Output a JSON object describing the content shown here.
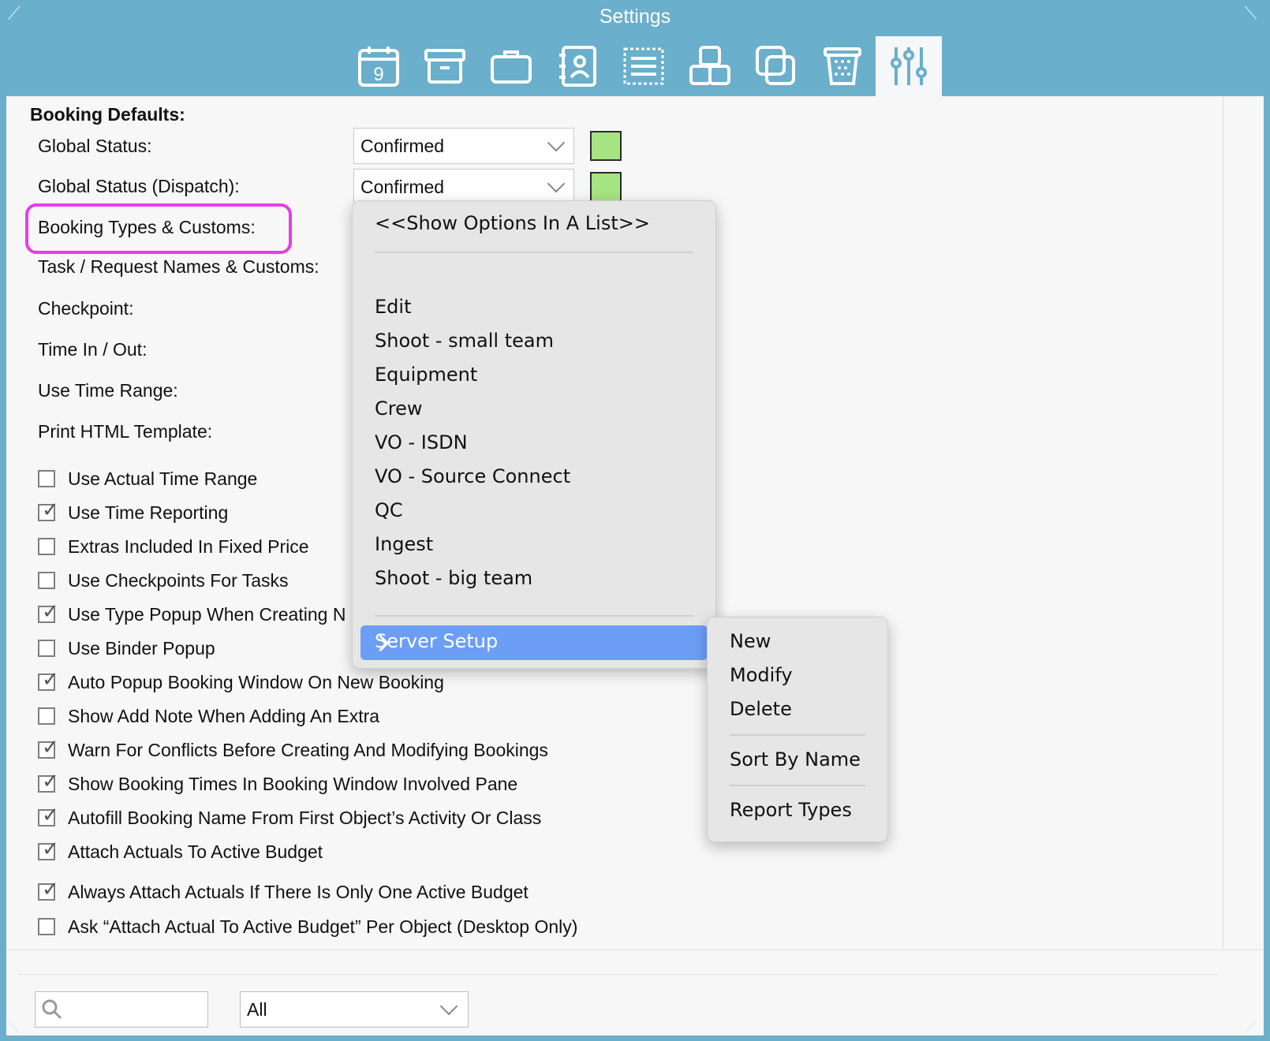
{
  "window": {
    "title": "Settings"
  },
  "toolbar": {
    "tools": [
      {
        "name": "calendar-icon",
        "day": "9"
      },
      {
        "name": "archive-box-icon"
      },
      {
        "name": "briefcase-icon"
      },
      {
        "name": "contacts-book-icon"
      },
      {
        "name": "list-document-icon"
      },
      {
        "name": "objects-icon"
      },
      {
        "name": "copy-icon"
      },
      {
        "name": "trash-icon"
      },
      {
        "name": "settings-sliders-icon",
        "active": true
      }
    ]
  },
  "booking_defaults": {
    "title": "Booking Defaults:",
    "labels": {
      "global_status": "Global Status:",
      "global_status_dispatch": "Global Status (Dispatch):",
      "booking_types": "Booking Types & Customs:",
      "task_request": "Task / Request Names & Customs:",
      "checkpoint": "Checkpoint:",
      "time_in_out": "Time In / Out:",
      "use_time_range": "Use Time Range:",
      "print_html": "Print HTML Template:"
    },
    "global_status_value": "Confirmed",
    "global_status_dispatch_value": "Confirmed",
    "status_color": "#a6e382"
  },
  "checkboxes": [
    {
      "label": "Use Actual Time Range",
      "checked": false
    },
    {
      "label": "Use Time Reporting",
      "checked": true
    },
    {
      "label": "Extras Included In Fixed Price",
      "checked": false
    },
    {
      "label": "Use Checkpoints For Tasks",
      "checked": false
    },
    {
      "label": "Use Type Popup When Creating N",
      "checked": true
    },
    {
      "label": "Use Binder Popup",
      "checked": false
    },
    {
      "label": "Auto Popup Booking Window On New Booking",
      "checked": true
    },
    {
      "label": "Show Add Note When Adding An Extra",
      "checked": false
    },
    {
      "label": "Warn For Conflicts Before Creating And Modifying Bookings",
      "checked": true
    },
    {
      "label": "Show Booking Times In Booking Window Involved Pane",
      "checked": true
    },
    {
      "label": "Autofill Booking Name From First Object’s Activity Or Class",
      "checked": true
    },
    {
      "label": "Attach Actuals To Active Budget",
      "checked": true
    },
    {
      "label": "Always Attach Actuals If There Is Only One Active Budget",
      "checked": true
    },
    {
      "label": "Ask “Attach Actual To Active Budget” Per Object (Desktop Only)",
      "checked": false
    }
  ],
  "context_menu": {
    "show_list": "<<Show Options In A List>>",
    "items": [
      "Edit",
      "Shoot - small team",
      "Equipment",
      "Crew",
      "VO - ISDN",
      "VO - Source Connect",
      "QC",
      "Ingest",
      "Shoot - big team"
    ],
    "highlighted": "Server Setup"
  },
  "submenu": {
    "items": [
      "New",
      "Modify",
      "Delete"
    ],
    "sort": "Sort By Name",
    "report": "Report Types"
  },
  "footer": {
    "filter_value": "All"
  }
}
